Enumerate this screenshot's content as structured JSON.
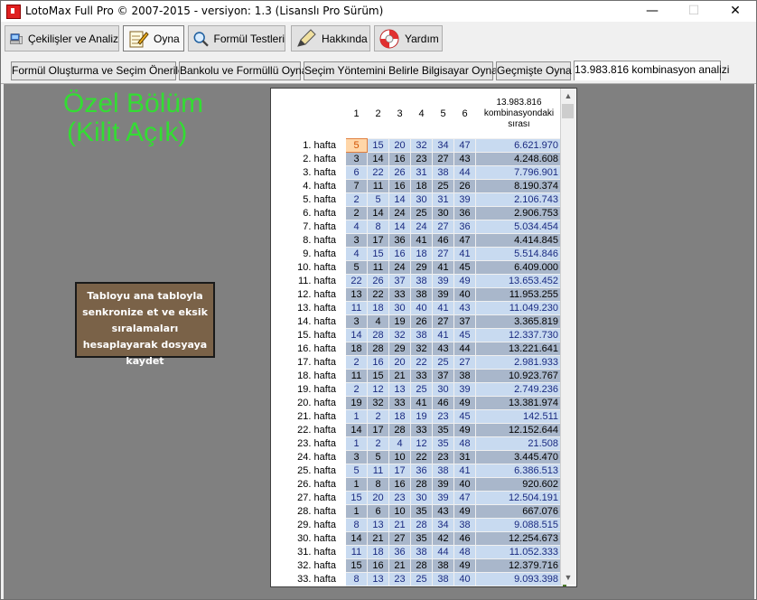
{
  "window": {
    "title": "LotoMax Full Pro © 2007-2015 - versiyon: 1.3 (Lisanslı Pro Sürüm)",
    "minimize": "—",
    "maximize": "☐",
    "close": "✕"
  },
  "toolbar": {
    "draws": "Çekilişler ve Analiz",
    "play": "Oyna",
    "formula": "Formül Testleri",
    "about": "Hakkında",
    "help": "Yardım"
  },
  "tabs": {
    "t1": "Formül Oluşturma ve Seçim Önerileri",
    "t2": "Bankolu ve Formüllü Oyna",
    "t3": "Seçim Yöntemini Belirle Bilgisayar Oynasın",
    "t4": "Geçmişte Oyna",
    "t5": "13.983.816 kombinasyon analizi"
  },
  "special": {
    "line1": "Özel Bölüm",
    "line2": "(Kilit Açık)",
    "sync_button": "Tabloyu ana tabloyla senkronize et ve eksik sıralamaları hesaplayarak dosyaya kaydet"
  },
  "grid": {
    "headers": [
      "1",
      "2",
      "3",
      "4",
      "5",
      "6"
    ],
    "order_header": "13.983.816 kombinasyondaki sırası",
    "rows": [
      {
        "label": "1. hafta",
        "nums": [
          5,
          15,
          20,
          32,
          34,
          47
        ],
        "order": "6.621.970"
      },
      {
        "label": "2. hafta",
        "nums": [
          3,
          14,
          16,
          23,
          27,
          43
        ],
        "order": "4.248.608"
      },
      {
        "label": "3. hafta",
        "nums": [
          6,
          22,
          26,
          31,
          38,
          44
        ],
        "order": "7.796.901"
      },
      {
        "label": "4. hafta",
        "nums": [
          7,
          11,
          16,
          18,
          25,
          26
        ],
        "order": "8.190.374"
      },
      {
        "label": "5. hafta",
        "nums": [
          2,
          5,
          14,
          30,
          31,
          39
        ],
        "order": "2.106.743"
      },
      {
        "label": "6. hafta",
        "nums": [
          2,
          14,
          24,
          25,
          30,
          36
        ],
        "order": "2.906.753"
      },
      {
        "label": "7. hafta",
        "nums": [
          4,
          8,
          14,
          24,
          27,
          36
        ],
        "order": "5.034.454"
      },
      {
        "label": "8. hafta",
        "nums": [
          3,
          17,
          36,
          41,
          46,
          47
        ],
        "order": "4.414.845"
      },
      {
        "label": "9. hafta",
        "nums": [
          4,
          15,
          16,
          18,
          27,
          41
        ],
        "order": "5.514.846"
      },
      {
        "label": "10. hafta",
        "nums": [
          5,
          11,
          24,
          29,
          41,
          45
        ],
        "order": "6.409.000"
      },
      {
        "label": "11. hafta",
        "nums": [
          22,
          26,
          37,
          38,
          39,
          49
        ],
        "order": "13.653.452"
      },
      {
        "label": "12. hafta",
        "nums": [
          13,
          22,
          33,
          38,
          39,
          40
        ],
        "order": "11.953.255"
      },
      {
        "label": "13. hafta",
        "nums": [
          11,
          18,
          30,
          40,
          41,
          43
        ],
        "order": "11.049.230"
      },
      {
        "label": "14. hafta",
        "nums": [
          3,
          4,
          19,
          26,
          27,
          37
        ],
        "order": "3.365.819"
      },
      {
        "label": "15. hafta",
        "nums": [
          14,
          28,
          32,
          38,
          41,
          45
        ],
        "order": "12.337.730"
      },
      {
        "label": "16. hafta",
        "nums": [
          18,
          28,
          29,
          32,
          43,
          44
        ],
        "order": "13.221.641"
      },
      {
        "label": "17. hafta",
        "nums": [
          2,
          16,
          20,
          22,
          25,
          27
        ],
        "order": "2.981.933"
      },
      {
        "label": "18. hafta",
        "nums": [
          11,
          15,
          21,
          33,
          37,
          38
        ],
        "order": "10.923.767"
      },
      {
        "label": "19. hafta",
        "nums": [
          2,
          12,
          13,
          25,
          30,
          39
        ],
        "order": "2.749.236"
      },
      {
        "label": "20. hafta",
        "nums": [
          19,
          32,
          33,
          41,
          46,
          49
        ],
        "order": "13.381.974"
      },
      {
        "label": "21. hafta",
        "nums": [
          1,
          2,
          18,
          19,
          23,
          45
        ],
        "order": "142.511"
      },
      {
        "label": "22. hafta",
        "nums": [
          14,
          17,
          28,
          33,
          35,
          49
        ],
        "order": "12.152.644"
      },
      {
        "label": "23. hafta",
        "nums": [
          1,
          2,
          4,
          12,
          35,
          48
        ],
        "order": "21.508"
      },
      {
        "label": "24. hafta",
        "nums": [
          3,
          5,
          10,
          22,
          23,
          31
        ],
        "order": "3.445.470"
      },
      {
        "label": "25. hafta",
        "nums": [
          5,
          11,
          17,
          36,
          38,
          41
        ],
        "order": "6.386.513"
      },
      {
        "label": "26. hafta",
        "nums": [
          1,
          8,
          16,
          28,
          39,
          40
        ],
        "order": "920.602"
      },
      {
        "label": "27. hafta",
        "nums": [
          15,
          20,
          23,
          30,
          39,
          47
        ],
        "order": "12.504.191"
      },
      {
        "label": "28. hafta",
        "nums": [
          1,
          6,
          10,
          35,
          43,
          49
        ],
        "order": "667.076"
      },
      {
        "label": "29. hafta",
        "nums": [
          8,
          13,
          21,
          28,
          34,
          38
        ],
        "order": "9.088.515"
      },
      {
        "label": "30. hafta",
        "nums": [
          14,
          21,
          27,
          35,
          42,
          46
        ],
        "order": "12.254.673"
      },
      {
        "label": "31. hafta",
        "nums": [
          11,
          18,
          36,
          38,
          44,
          48
        ],
        "order": "11.052.333"
      },
      {
        "label": "32. hafta",
        "nums": [
          15,
          16,
          21,
          28,
          38,
          49
        ],
        "order": "12.379.716"
      },
      {
        "label": "33. hafta",
        "nums": [
          8,
          13,
          23,
          25,
          38,
          40
        ],
        "order": "9.093.398"
      }
    ]
  }
}
